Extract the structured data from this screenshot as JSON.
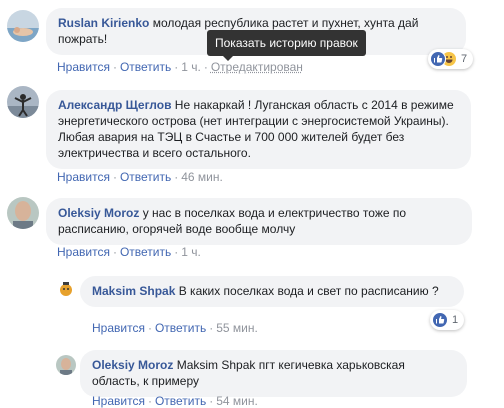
{
  "comments": [
    {
      "author": "Ruslan Kirienko",
      "text": "молодая республика растет и пухнет, хунта дай пожрать!",
      "like": "Нравится",
      "reply": "Ответить",
      "time": "1 ч.",
      "edited": "Отредактирован",
      "reaction_count": "7"
    },
    {
      "author": "Александр Щеглов",
      "text": "Не накаркай ! Луганская область с 2014 в режиме энергетического острова (нет интеграции с энергосистемой Украины). Любая авария на ТЭЦ в Счастье и 700 000 жителей будет без электричества и всего остального.",
      "like": "Нравится",
      "reply": "Ответить",
      "time": "46 мин."
    },
    {
      "author": "Oleksiy Moroz",
      "text": "у нас в поселках вода и електричество тоже по расписанию, огорячей воде вообще молчу",
      "like": "Нравится",
      "reply": "Ответить",
      "time": "1 ч."
    },
    {
      "author": "Maksim Shpak",
      "text": "В каких поселках вода и свет по расписанию ?",
      "like": "Нравится",
      "reply": "Ответить",
      "time": "55 мин.",
      "reaction_count": "1"
    },
    {
      "author": "Oleksiy Moroz",
      "text": "Maksim Shpak пгт кегичевка харьковская область, к примеру",
      "like": "Нравится",
      "reply": "Ответить",
      "time": "54 мин."
    }
  ],
  "tooltip": "Показать историю правок"
}
